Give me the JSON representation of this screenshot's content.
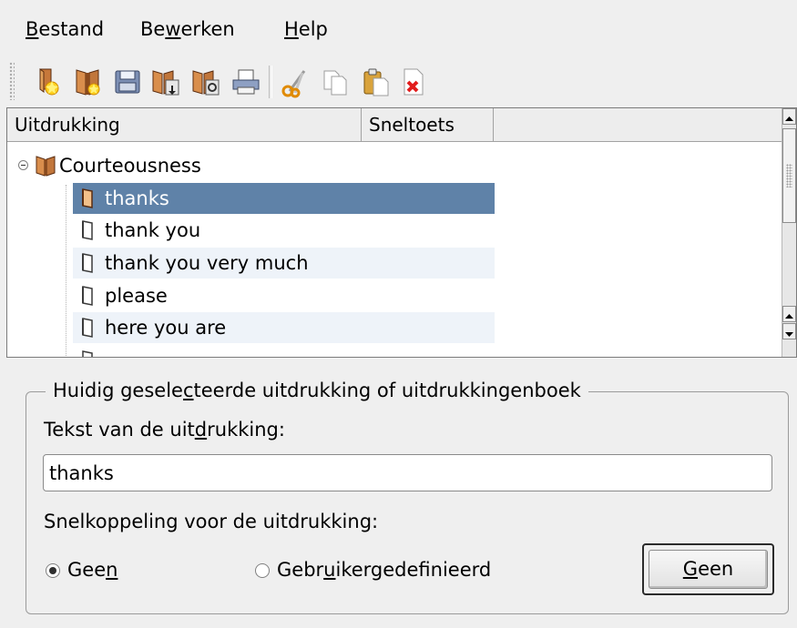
{
  "menubar": {
    "items": [
      {
        "label": "Bestand",
        "mnemonic": "B",
        "rest": "estand"
      },
      {
        "label": "Bewerken",
        "pre": "Be",
        "mnemonic": "w",
        "rest": "erken"
      },
      {
        "label": "Help",
        "mnemonic": "H",
        "rest": "elp"
      }
    ]
  },
  "toolbar": {
    "buttons": [
      {
        "icon": "new-phrase-icon"
      },
      {
        "icon": "new-phrasebook-icon"
      },
      {
        "icon": "save-icon"
      },
      {
        "icon": "import-phrasebook-icon"
      },
      {
        "icon": "export-phrasebook-icon"
      },
      {
        "icon": "print-icon"
      },
      {
        "icon": "cut-icon"
      },
      {
        "icon": "copy-icon"
      },
      {
        "icon": "paste-icon"
      },
      {
        "icon": "delete-icon"
      }
    ]
  },
  "tree": {
    "columns": [
      "Uitdrukking",
      "Sneltoets"
    ],
    "book": "Courteousness",
    "phrases": [
      "thanks",
      "thank you",
      "thank you very much",
      "please",
      "here you are"
    ],
    "selected": "thanks"
  },
  "group": {
    "title_pre": "Huidig gesele",
    "title_mn": "c",
    "title_post": "teerde uitdrukking of uitdrukkingenboek",
    "text_label_pre": "Tekst van de uit",
    "text_label_mn": "d",
    "text_label_post": "rukking:",
    "text_value": "thanks",
    "shortcut_label": "Snelkoppeling voor de uitdrukking:",
    "radio_none_pre": "Gee",
    "radio_none_mn": "n",
    "radio_custom_pre": "Gebr",
    "radio_custom_mn": "u",
    "radio_custom_post": "ikergedefinieerd",
    "button_mn": "G",
    "button_rest": "een"
  }
}
